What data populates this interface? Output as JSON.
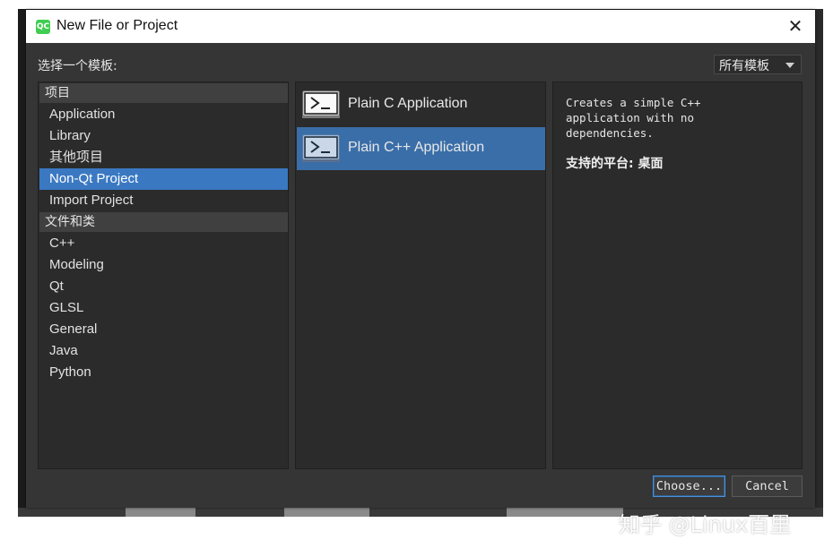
{
  "window": {
    "icon_text": "QC",
    "title": "New File or Project",
    "close_glyph": "✕"
  },
  "prompt_label": "选择一个模板:",
  "filter": {
    "selected": "所有模板"
  },
  "categories": {
    "group1": "项目",
    "group1_items": [
      "Application",
      "Library",
      "其他项目",
      "Non-Qt Project",
      "Import Project"
    ],
    "group2": "文件和类",
    "group2_items": [
      "C++",
      "Modeling",
      "Qt",
      "GLSL",
      "General",
      "Java",
      "Python"
    ],
    "selected": "Non-Qt Project"
  },
  "templates": [
    {
      "label": "Plain C Application",
      "icon": "terminal-icon"
    },
    {
      "label": "Plain C++ Application",
      "icon": "terminal-icon"
    }
  ],
  "selected_template": "Plain C++ Application",
  "description": {
    "text": "Creates a simple C++\napplication with no\ndependencies.",
    "platform": "支持的平台: 桌面"
  },
  "buttons": {
    "choose": "Choose...",
    "cancel": "Cancel"
  },
  "watermark": "知乎 @Linux百里",
  "colors": {
    "selection": "#3a78c2",
    "panel_bg": "#2b2b2b",
    "dialog_bg": "#353535",
    "qt_green": "#41cd52"
  }
}
